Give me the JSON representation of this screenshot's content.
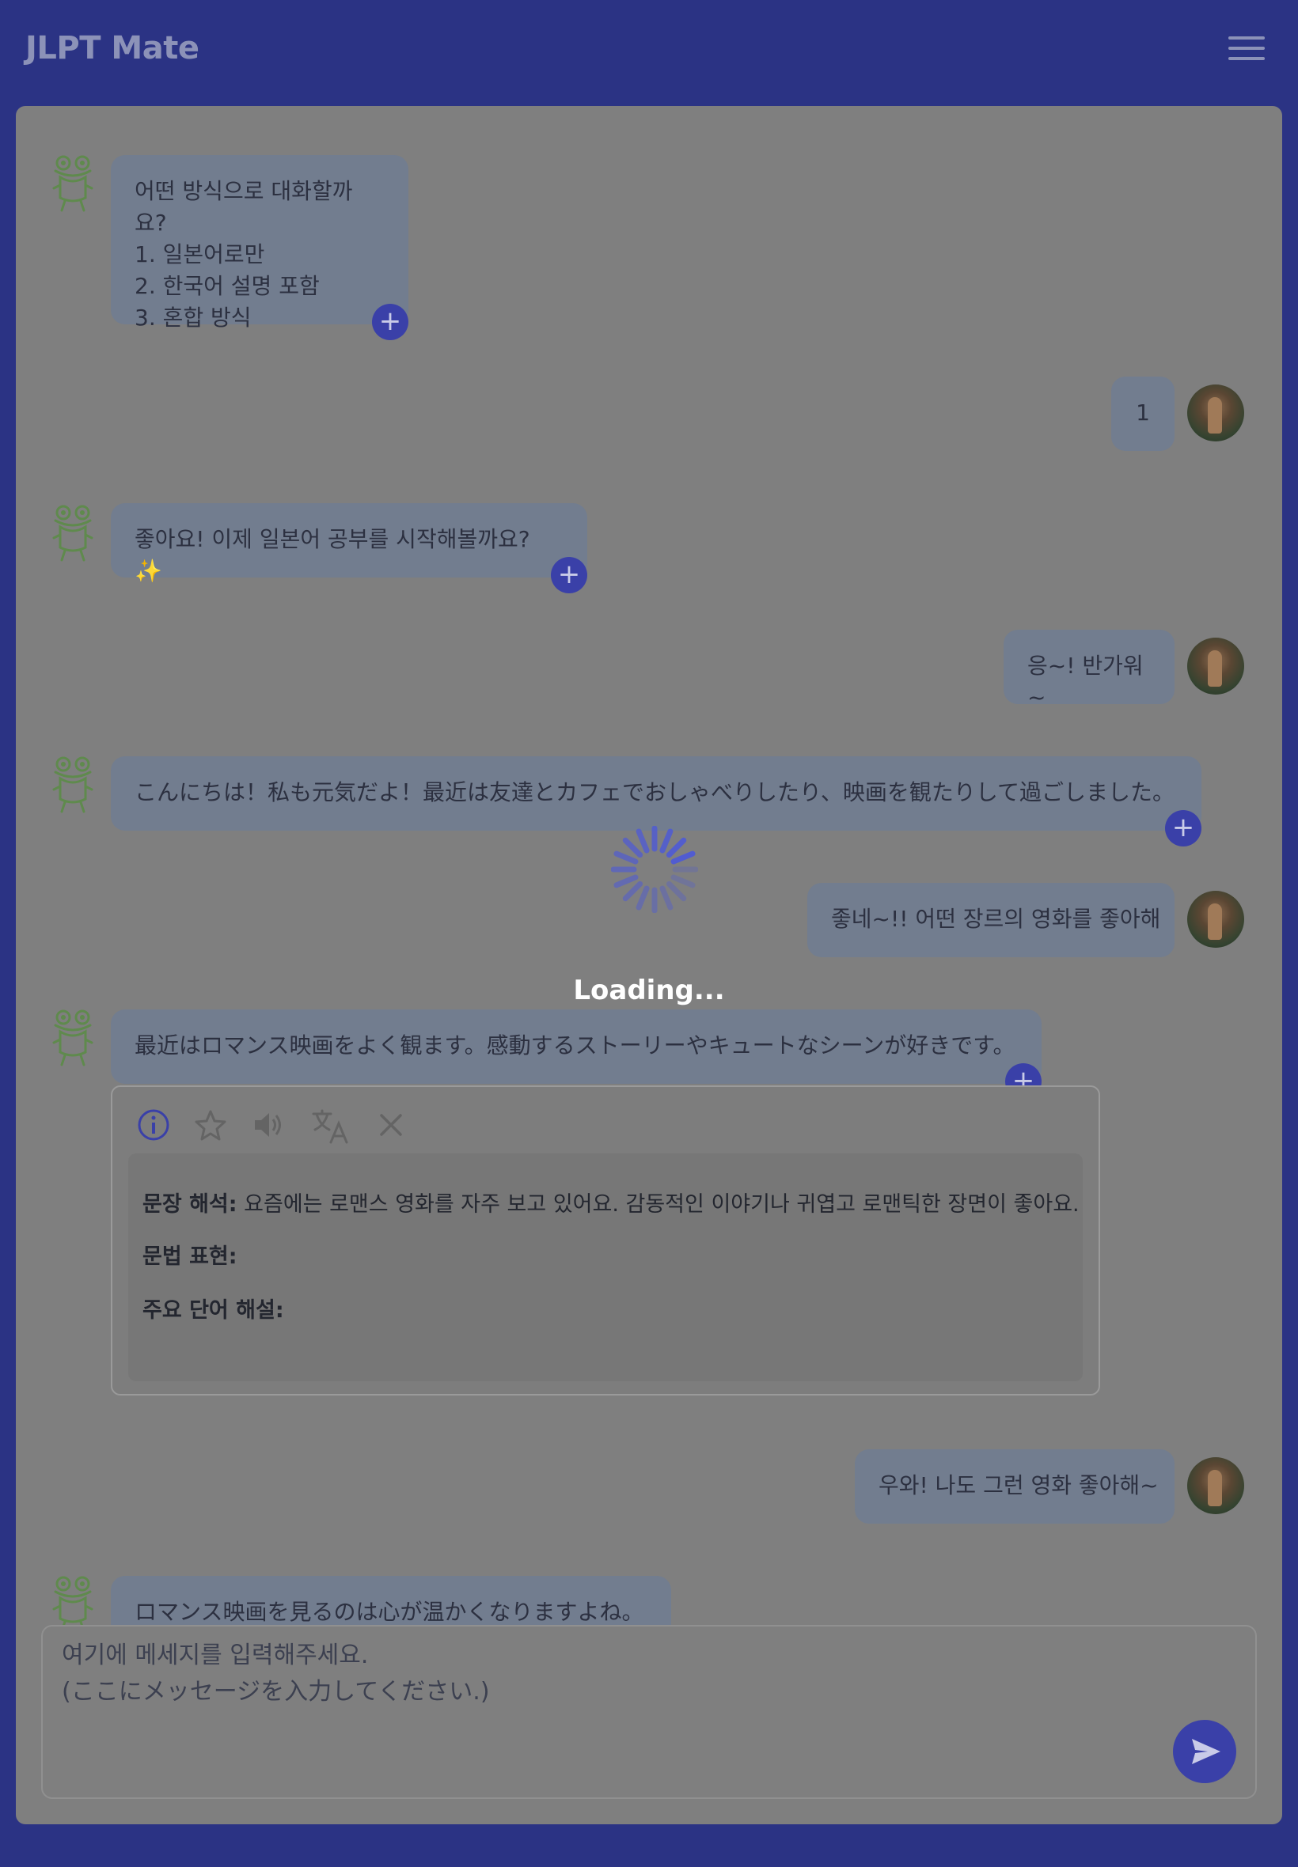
{
  "app": {
    "title": "JLPT Mate"
  },
  "messages": [
    {
      "role": "bot",
      "text": "어떤 방식으로 대화할까요?\n1. 일본어로만\n2. 한국어 설명 포함\n3. 혼합 방식"
    },
    {
      "role": "user",
      "text": "1"
    },
    {
      "role": "bot",
      "text": "좋아요! 이제 일본어 공부를 시작해볼까요? ✨"
    },
    {
      "role": "user",
      "text": "응~! 반가워~"
    },
    {
      "role": "bot",
      "text": "こんにちは！私も元気だよ！最近は友達とカフェでおしゃべりしたり、映画を観たりして過ごしました。"
    },
    {
      "role": "user",
      "text": "좋네~!! 어떤 장르의 영화를 좋아해"
    },
    {
      "role": "bot",
      "text": "最近はロマンス映画をよく観ます。感動するストーリーやキュートなシーンが好きです。"
    },
    {
      "role": "user",
      "text": "우와! 나도 그런 영화 좋아해~"
    },
    {
      "role": "bot",
      "text": "ロマンス映画を見るのは心が温かくなりますよね。"
    }
  ],
  "detail": {
    "toolbar": [
      "info-icon",
      "star-icon",
      "speaker-icon",
      "translate-icon",
      "close-icon"
    ],
    "sentence_label": "문장 해석:",
    "sentence_text": " 요즘에는 로맨스 영화를 자주 보고 있어요. 감동적인 이야기나 귀엽고 로맨틱한 장면이 좋아요.",
    "grammar_label": "문법 표현:",
    "vocab_label": "주요 단어 해설:"
  },
  "input": {
    "placeholder": "여기에 메세지를 입력해주세요.\n(ここにメッセージを入力してください.)"
  },
  "overlay": {
    "loading_text": "Loading..."
  },
  "colors": {
    "header": "#2b3384",
    "accent": "#3a40a8",
    "spinner": "#4f5bd5"
  }
}
